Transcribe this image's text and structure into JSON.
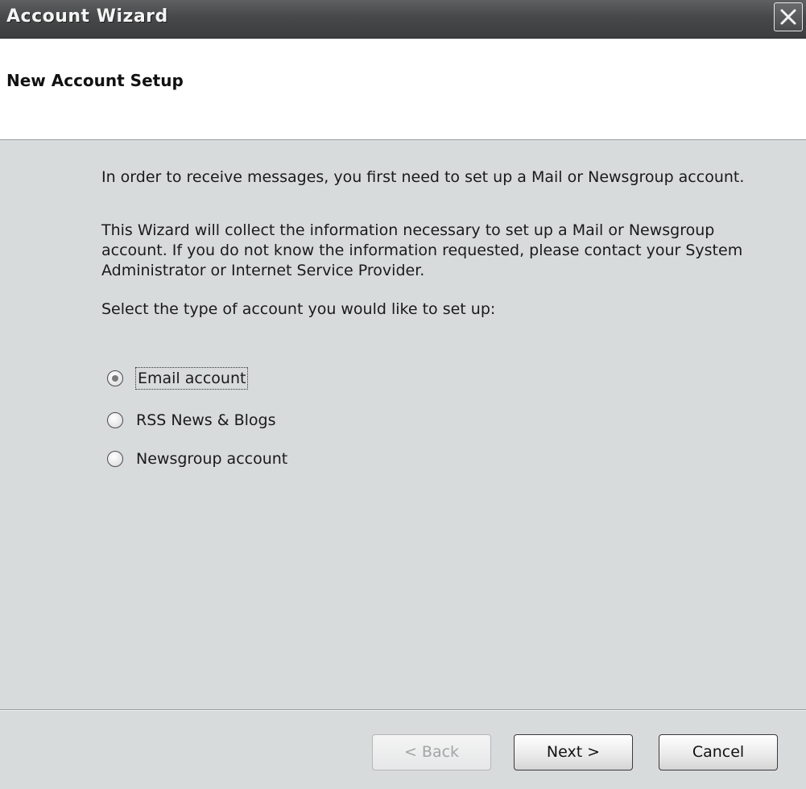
{
  "window": {
    "title": "Account Wizard",
    "close_icon": "close-icon"
  },
  "header": {
    "title": "New Account Setup"
  },
  "content": {
    "intro_1": "In order to receive messages, you first need to set up a Mail or Newsgroup account.",
    "intro_2": "This Wizard will collect the information necessary to set up a Mail or Newsgroup account. If you do not know the information requested, please contact your System Administrator or Internet Service Provider.",
    "prompt": "Select the type of account you would like to set up:"
  },
  "options": {
    "email": {
      "label": "Email account",
      "selected": true
    },
    "rss": {
      "label": "RSS News & Blogs",
      "selected": false
    },
    "newsgroup": {
      "label": "Newsgroup account",
      "selected": false
    }
  },
  "buttons": {
    "back": "< Back",
    "next": "Next >",
    "cancel": "Cancel"
  }
}
